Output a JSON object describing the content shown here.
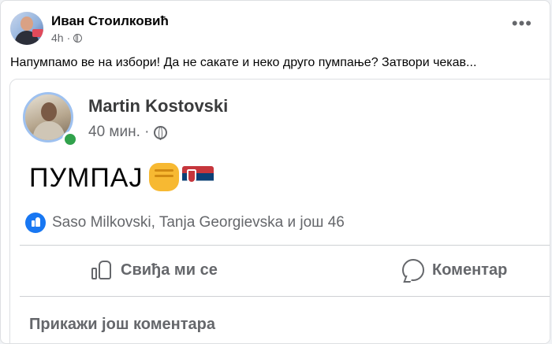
{
  "post": {
    "author": "Иван Стоилковић",
    "time": "4h",
    "menu": "•••",
    "text": "Напумпамо ве на избори! Да не сакате и неко друго пумпање? Затвори чекав..."
  },
  "shared_post": {
    "author": "Martin Kostovski",
    "time": "40 мин. ·",
    "text": "ПУМПАЈ",
    "reactions": "Saso Milkovski, Tanja Georgievska и још 46",
    "like_label": "Свиђа ми се",
    "comment_label": "Коментар",
    "more_comments": "Прикажи још коментара"
  },
  "colors": {
    "accent": "#1877f2",
    "online": "#31a24c",
    "muted_text": "#65676b"
  },
  "icons": [
    "avatar",
    "globe-icon",
    "more-options-icon",
    "fist-emoji",
    "serbian-flag-emoji",
    "like-reaction-icon",
    "like-icon",
    "comment-icon"
  ]
}
